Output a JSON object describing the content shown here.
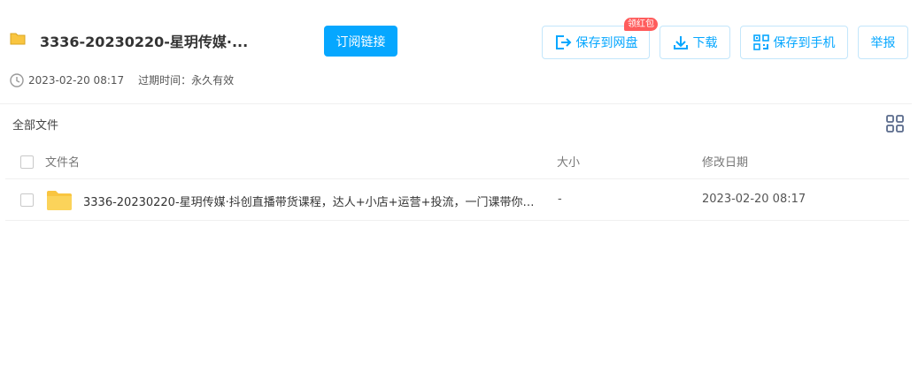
{
  "share": {
    "title": "3336-20230220-星玥传媒·...",
    "subscribe_label": "订阅链接",
    "date": "2023-02-20 08:17",
    "expire_label": "过期时间：永久有效"
  },
  "actions": {
    "save_to_disk": "保存到网盘",
    "save_badge": "领红包",
    "download": "下载",
    "save_to_phone": "保存到手机",
    "report": "举报"
  },
  "breadcrumb": "全部文件",
  "table": {
    "headers": {
      "name": "文件名",
      "size": "大小",
      "modified": "修改日期"
    },
    "rows": [
      {
        "name": "3336-20230220-星玥传媒·抖创直播带货课程，达人+小店+运营+投流，一门课带你玩转抖音直播带货",
        "size": "-",
        "modified": "2023-02-20 08:17"
      }
    ]
  },
  "colors": {
    "accent": "#06a7ff",
    "badge": "#ff5c5c",
    "folder": "#f9c540"
  },
  "icons": [
    "folder-icon",
    "save-to-disk-icon",
    "download-icon",
    "phone-qr-icon",
    "clock-icon",
    "grid-view-icon"
  ]
}
